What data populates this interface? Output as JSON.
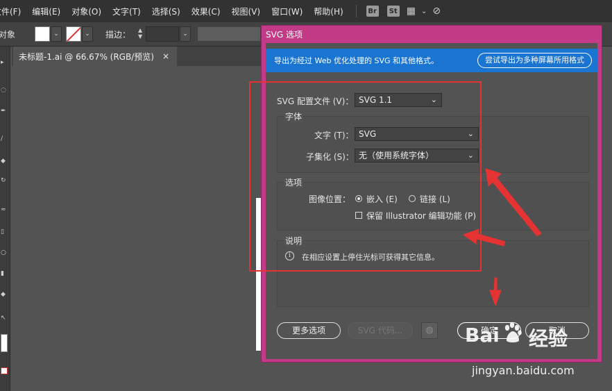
{
  "menubar": {
    "items": [
      "文件(F)",
      "编辑(E)",
      "对象(O)",
      "文字(T)",
      "选择(S)",
      "效果(C)",
      "视图(V)",
      "窗口(W)",
      "帮助(H)"
    ],
    "bridge_icon": "Br",
    "stock_icon": "St"
  },
  "controlbar": {
    "object_label": "对象",
    "stroke_label": "描边："
  },
  "document_tab": {
    "title": "未标题-1.ai @ 66.67% (RGB/预览)",
    "close": "×"
  },
  "dialog": {
    "title": "SVG 选项",
    "banner_text": "导出为经过 Web 优化处理的 SVG 和其他格式。",
    "banner_button": "尝试导出为多种屏幕所用格式",
    "profile_label": "SVG 配置文件 (V)：",
    "profile_value": "SVG 1.1",
    "font_group_label": "字体",
    "text_label": "文字 (T)：",
    "text_value": "SVG",
    "subset_label": "子集化 (S)：",
    "subset_value": "无（使用系统字体）",
    "options_group_label": "选项",
    "image_location_label": "图像位置：",
    "embed_label": "嵌入 (E)",
    "link_label": "链接 (L)",
    "preserve_label": "保留 Illustrator 编辑功能 (P)",
    "description_group_label": "说明",
    "description_text": "在相应设置上停住光标可获得其它信息。",
    "more_options": "更多选项",
    "svg_code": "SVG 代码...",
    "ok": "确定",
    "cancel": "取消"
  },
  "watermark": {
    "logo_text_left": "Bai",
    "logo_text_right": "经验",
    "url": "jingyan.baidu.com"
  },
  "colors": {
    "banner_blue": "#1a74d1",
    "dialog_magenta": "#c33a87",
    "annotation_red": "#e53333"
  }
}
